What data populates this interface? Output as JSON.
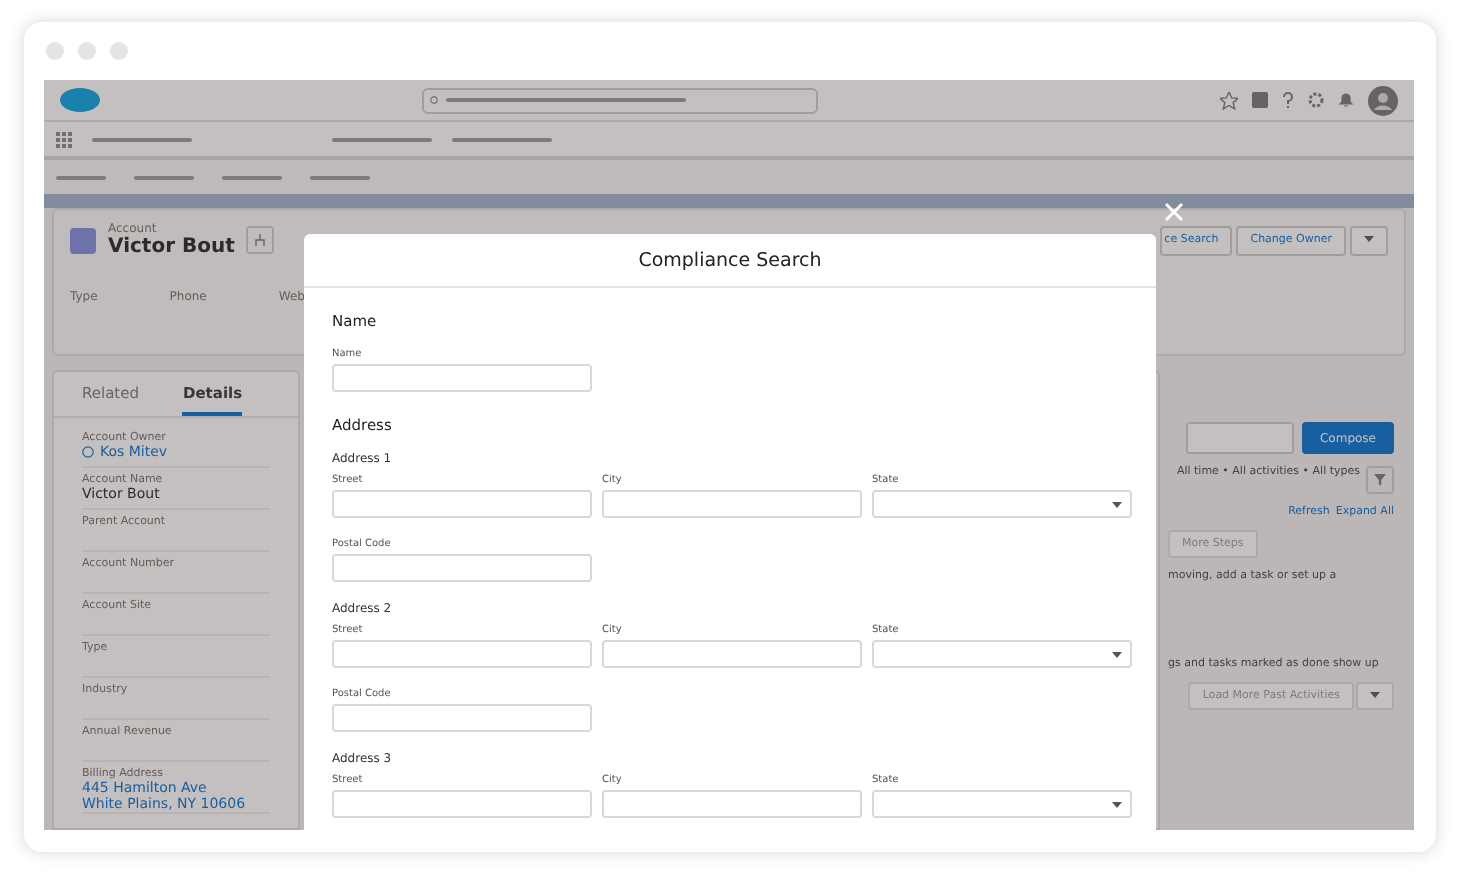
{
  "app": {
    "record": {
      "object": "Account",
      "name": "Victor Bout",
      "buttons": [
        "ce Search",
        "Change Owner"
      ],
      "fields": [
        "Type",
        "Phone",
        "Web"
      ]
    },
    "detail_tabs": [
      {
        "label": "Related",
        "selected": false
      },
      {
        "label": "Details",
        "selected": true
      }
    ],
    "details": [
      {
        "label": "Account Owner",
        "value": "Kos Mitev",
        "kind": "user"
      },
      {
        "label": "Account Name",
        "value": "Victor Bout",
        "kind": "text"
      },
      {
        "label": "Parent Account"
      },
      {
        "label": "Account Number"
      },
      {
        "label": "Account Site"
      },
      {
        "label": "Type"
      },
      {
        "label": "Industry"
      },
      {
        "label": "Annual Revenue"
      },
      {
        "label": "Billing Address",
        "value": "445 Hamilton Ave",
        "value_2": "White Plains, NY 10606",
        "kind": "link"
      }
    ],
    "activity": {
      "compose_button": "Compose",
      "filter_text": "All time • All activities • All types",
      "links": [
        "Refresh",
        "Expand All"
      ],
      "more_steps_button": "More Steps",
      "upcoming_text": "moving, add a task or set up a",
      "past_text": "gs and tasks marked as done show up",
      "load_more_button": "Load More Past Activities"
    }
  },
  "modal": {
    "title": "Compliance Search",
    "sections": [
      {
        "heading": "Name",
        "groups": [
          {
            "rows": [
              [
                {
                  "label": "Name",
                  "kind": "text"
                }
              ]
            ]
          }
        ]
      },
      {
        "heading": "Address",
        "groups": [
          {
            "title": "Address 1",
            "rows": [
              [
                {
                  "label": "Street",
                  "kind": "text"
                },
                {
                  "label": "City",
                  "kind": "text"
                },
                {
                  "label": "State",
                  "kind": "select"
                }
              ],
              [
                {
                  "label": "Postal Code",
                  "kind": "text"
                }
              ]
            ]
          },
          {
            "title": "Address 2",
            "rows": [
              [
                {
                  "label": "Street",
                  "kind": "text"
                },
                {
                  "label": "City",
                  "kind": "text"
                },
                {
                  "label": "State",
                  "kind": "select"
                }
              ],
              [
                {
                  "label": "Postal Code",
                  "kind": "text"
                }
              ]
            ]
          },
          {
            "title": "Address 3",
            "rows": [
              [
                {
                  "label": "Street",
                  "kind": "text"
                },
                {
                  "label": "City",
                  "kind": "text"
                },
                {
                  "label": "State",
                  "kind": "select"
                }
              ]
            ]
          }
        ]
      }
    ]
  }
}
